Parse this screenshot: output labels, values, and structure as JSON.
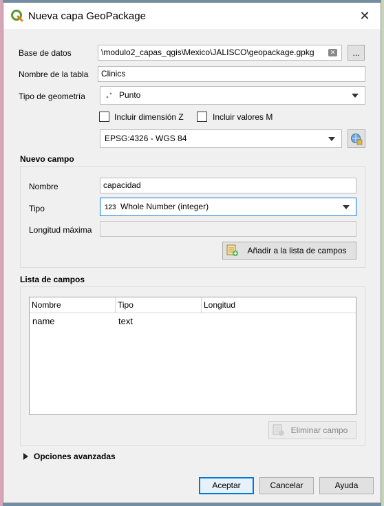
{
  "window": {
    "title": "Nueva capa GeoPackage",
    "close_glyph": "✕"
  },
  "form": {
    "database_label": "Base de datos",
    "database_value": "\\modulo2_capas_qgis\\Mexico\\JALISCO\\geopackage.gpkg",
    "browse_label": "...",
    "table_label": "Nombre de la tabla",
    "table_value": "Clinics",
    "geometry_label": "Tipo de geometría",
    "geometry_value": "Punto",
    "include_z_label": "Incluir dimensión Z",
    "include_m_label": "Incluir valores M",
    "crs_value": "EPSG:4326 - WGS 84"
  },
  "new_field": {
    "title": "Nuevo campo",
    "name_label": "Nombre",
    "name_value": "capacidad",
    "type_label": "Tipo",
    "type_prefix": "123",
    "type_value": "Whole Number (integer)",
    "maxlen_label": "Longitud máxima",
    "add_button": "Añadir a la lista de campos"
  },
  "field_list": {
    "title": "Lista de campos",
    "columns": [
      "Nombre",
      "Tipo",
      "Longitud"
    ],
    "rows": [
      {
        "name": "name",
        "type": "text"
      }
    ],
    "remove_button": "Eliminar campo"
  },
  "advanced": {
    "label": "Opciones avanzadas"
  },
  "buttons": {
    "accept": "Aceptar",
    "cancel": "Cancelar",
    "help": "Ayuda"
  },
  "colors": {
    "accent": "#0078d7",
    "qgis_green": "#589632",
    "qgis_yellow": "#ee7913"
  },
  "icons": [
    "qgis-logo-icon",
    "close-icon",
    "clear-icon",
    "point-geometry-icon",
    "dropdown-arrow-icon",
    "crs-selector-icon",
    "add-field-icon",
    "remove-field-icon",
    "expand-arrow-icon"
  ]
}
